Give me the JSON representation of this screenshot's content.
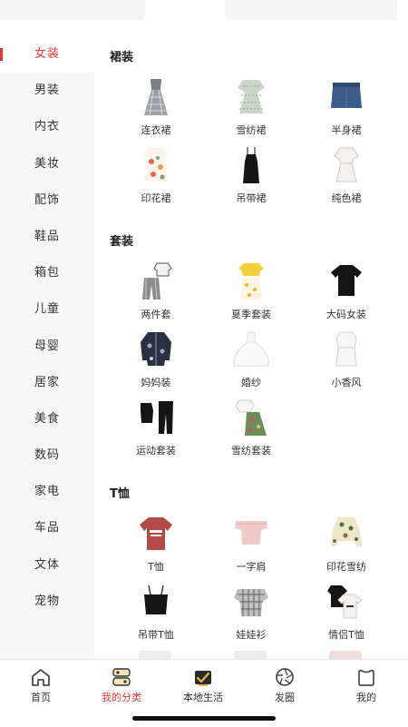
{
  "sidebar": {
    "items": [
      {
        "label": "女装",
        "active": true
      },
      {
        "label": "男装"
      },
      {
        "label": "内衣"
      },
      {
        "label": "美妆"
      },
      {
        "label": "配饰"
      },
      {
        "label": "鞋品"
      },
      {
        "label": "箱包"
      },
      {
        "label": "儿童"
      },
      {
        "label": "母婴"
      },
      {
        "label": "居家"
      },
      {
        "label": "美食"
      },
      {
        "label": "数码"
      },
      {
        "label": "家电"
      },
      {
        "label": "车品"
      },
      {
        "label": "文体"
      },
      {
        "label": "宠物"
      }
    ]
  },
  "sections": [
    {
      "title": "裙装",
      "items": [
        {
          "label": "连衣裙",
          "icon": "plaid-dress-icon"
        },
        {
          "label": "雪纺裙",
          "icon": "chiffon-dress-icon"
        },
        {
          "label": "半身裙",
          "icon": "denim-skirt-icon"
        },
        {
          "label": "印花裙",
          "icon": "floral-dress-icon"
        },
        {
          "label": "吊带裙",
          "icon": "slip-dress-icon"
        },
        {
          "label": "纯色裙",
          "icon": "white-dress-icon"
        }
      ]
    },
    {
      "title": "套装",
      "items": [
        {
          "label": "两件套",
          "icon": "two-piece-icon"
        },
        {
          "label": "夏季套装",
          "icon": "summer-set-icon"
        },
        {
          "label": "大码女装",
          "icon": "black-tee-icon"
        },
        {
          "label": "妈妈装",
          "icon": "mom-jacket-icon"
        },
        {
          "label": "婚纱",
          "icon": "wedding-dress-icon"
        },
        {
          "label": "小香风",
          "icon": "white-suit-icon"
        },
        {
          "label": "运动套装",
          "icon": "sport-set-icon"
        },
        {
          "label": "雪纺套装",
          "icon": "chiffon-set-icon"
        }
      ]
    },
    {
      "title": "T恤",
      "items": [
        {
          "label": "T恤",
          "icon": "red-tshirt-icon"
        },
        {
          "label": "一字肩",
          "icon": "off-shoulder-icon"
        },
        {
          "label": "印花雪纺",
          "icon": "floral-blouse-icon"
        },
        {
          "label": "吊带T恤",
          "icon": "camisole-icon"
        },
        {
          "label": "娃娃衫",
          "icon": "gingham-top-icon"
        },
        {
          "label": "情侣T恤",
          "icon": "couple-tees-icon"
        }
      ]
    }
  ],
  "bottom_nav": [
    {
      "label": "首页",
      "icon": "home-icon"
    },
    {
      "label": "我的分类",
      "icon": "category-icon",
      "active": true
    },
    {
      "label": "本地生活",
      "icon": "local-life-icon"
    },
    {
      "label": "发圈",
      "icon": "aperture-icon"
    },
    {
      "label": "我的",
      "icon": "profile-icon"
    }
  ],
  "colors": {
    "accent": "#e53935",
    "sidebar_bg": "#f7f7f7",
    "text": "#333333"
  }
}
